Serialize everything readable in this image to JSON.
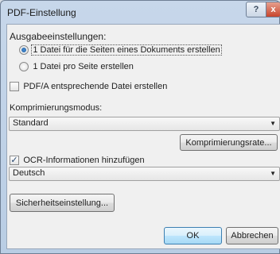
{
  "window": {
    "title": "PDF-Einstellung"
  },
  "titlebar": {
    "help_glyph": "?",
    "close_glyph": "x"
  },
  "output_settings": {
    "label": "Ausgabeeinstellungen:",
    "radio_one_file": "1 Datei für die Seiten eines Dokuments erstellen",
    "radio_per_page": "1 Datei pro Seite erstellen",
    "selected": "radio_one_file"
  },
  "pdfa": {
    "label": "PDF/A entsprechende Datei erstellen",
    "checked": false
  },
  "compression": {
    "label": "Komprimierungsmodus:",
    "value": "Standard",
    "rate_button": "Komprimierungsrate..."
  },
  "ocr": {
    "label": "OCR-Informationen hinzufügen",
    "checked": true,
    "language": "Deutsch"
  },
  "security_button": "Sicherheitseinstellung...",
  "footer": {
    "ok": "OK",
    "cancel": "Abbrechen"
  },
  "icons": {
    "dropdown": "chevron-down-icon",
    "checkmark": "checkmark-icon",
    "radio_dot": "radio-dot-icon"
  },
  "colors": {
    "title_bar": "#c7d7ea",
    "client_bg": "#f0f0f0",
    "default_button": "#bee6fd",
    "close_button": "#c8452d"
  }
}
